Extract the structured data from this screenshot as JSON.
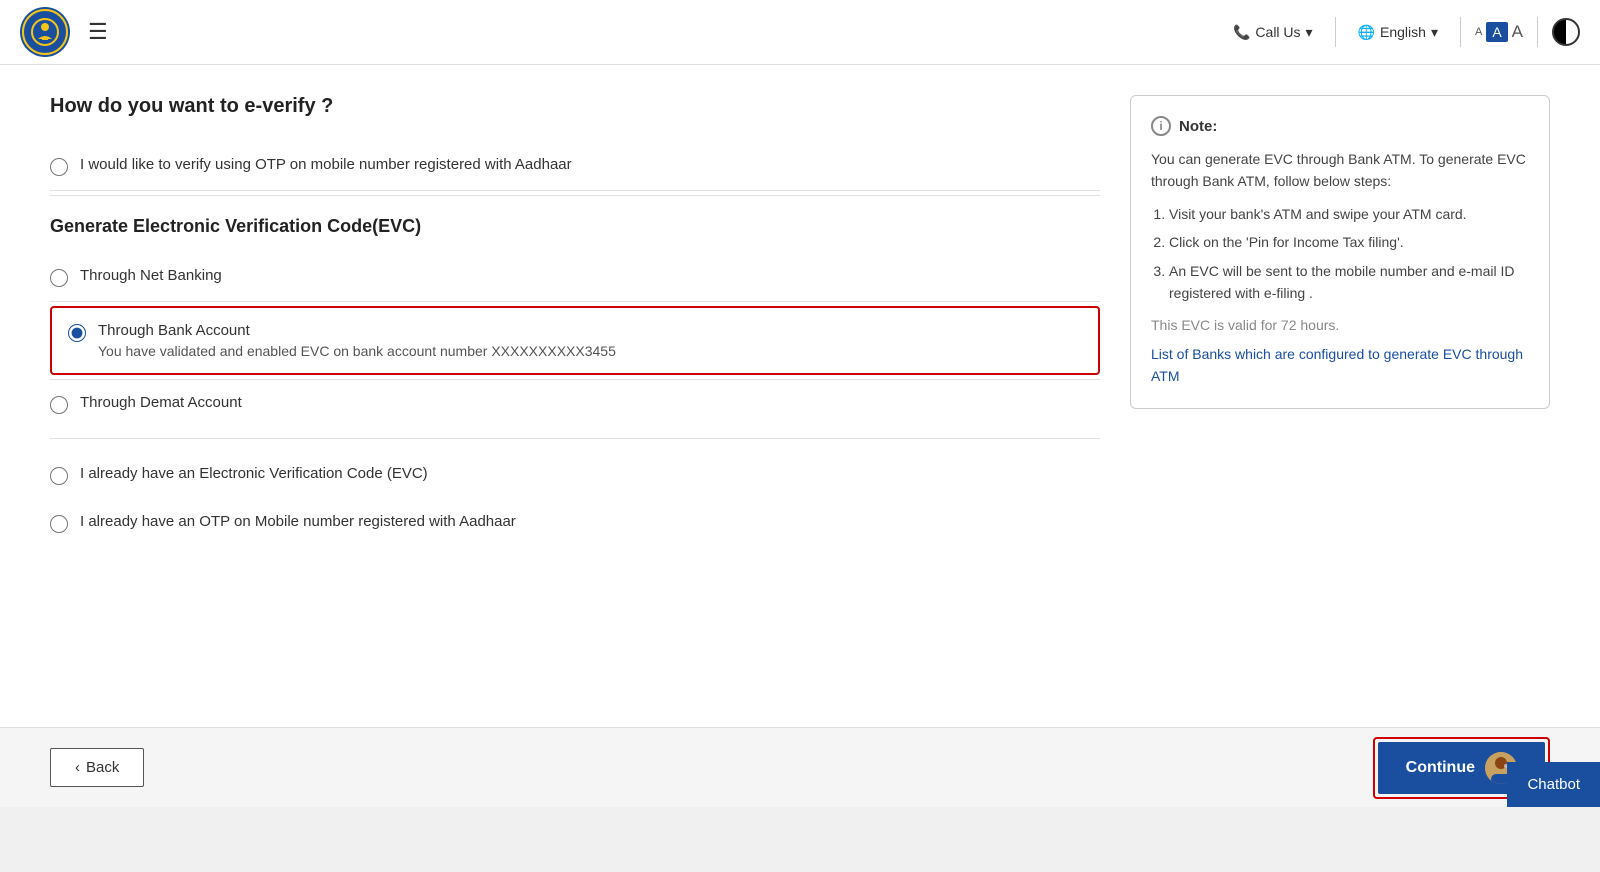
{
  "header": {
    "hamburger_icon": "☰",
    "call_us_label": "Call Us",
    "language_label": "English",
    "font_small": "A",
    "font_medium": "A",
    "font_large": "A"
  },
  "page": {
    "question": "How do you want to e-verify ?",
    "options": [
      {
        "id": "aadhaar-otp",
        "label": "I would like to verify using OTP on mobile number registered with Aadhaar",
        "selected": false
      }
    ],
    "evc_section_title": "Generate Electronic Verification Code(EVC)",
    "evc_options": [
      {
        "id": "net-banking",
        "label": "Through Net Banking",
        "selected": false
      },
      {
        "id": "bank-account",
        "label": "Through Bank Account",
        "sub_label": "You have validated and enabled EVC on bank account number XXXXXXXXXX3455",
        "selected": true
      },
      {
        "id": "demat-account",
        "label": "Through Demat Account",
        "selected": false
      }
    ],
    "other_options": [
      {
        "id": "already-have-evc",
        "label": "I already have an Electronic Verification Code (EVC)",
        "selected": false
      },
      {
        "id": "already-have-otp",
        "label": "I already have an OTP on Mobile number registered with Aadhaar",
        "selected": false
      }
    ]
  },
  "note": {
    "title": "Note:",
    "intro": "You can generate EVC through Bank ATM. To generate EVC through Bank ATM, follow below steps:",
    "steps": [
      "Visit your bank's ATM and swipe your ATM card.",
      "Click on the 'Pin for Income Tax filing'.",
      "An EVC will be sent to the mobile number and e-mail ID registered with e-filing ."
    ],
    "validity": "This EVC is valid for 72 hours.",
    "link_text": "List of Banks which are configured to generate EVC through ATM"
  },
  "buttons": {
    "back_label": "‹ Back",
    "continue_label": "Continue"
  },
  "chatbot": {
    "label": "Chatbot"
  }
}
